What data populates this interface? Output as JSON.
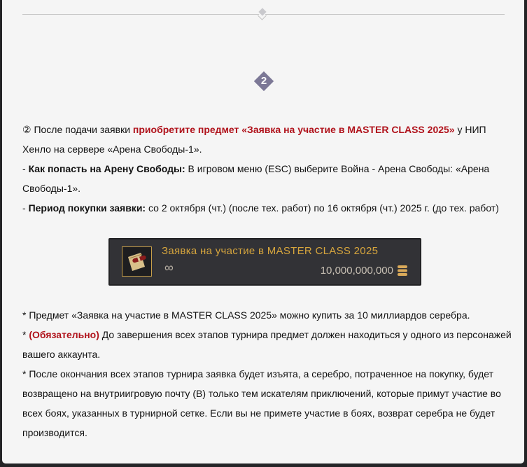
{
  "step_number": "2",
  "intro": {
    "marker": "②",
    "t1": " После подачи заявки ",
    "highlight": "приобретите предмет «Заявка на участие в MASTER CLASS 2025»",
    "t2": " у НИП Хенло на сервере «Арена Свободы-1»."
  },
  "how_to": {
    "prefix": "- ",
    "label": "Как попасть на Арену Свободы:",
    "text": " В игровом меню (ESC) выберите Война - Арена Свободы: «Арена Свободы-1»."
  },
  "period": {
    "prefix": "- ",
    "label": "Период покупки заявки:",
    "text": " со 2 октября (чт.) (после тех. работ) по 16 октября (чт.) 2025 г. (до тех. работ)"
  },
  "item_card": {
    "name": "Заявка на участие в MASTER CLASS 2025",
    "quantity": "∞",
    "price": "10,000,000,000",
    "icon": "scroll-icon",
    "currency_icon": "silver-coins-icon"
  },
  "notes": {
    "n1": " * Предмет «Заявка на участие в MASTER CLASS 2025» можно купить за 10 миллиардов серебра.",
    "n2_prefix": " * ",
    "n2_required": "(Обязательно)",
    "n2_text": " До завершения всех этапов турнира предмет должен находиться у одного из персонажей вашего аккаунта.",
    "n3": " * После окончания всех этапов турнира заявка будет изъята, а серебро, потраченное на покупку, будет возвращено на внутриигровую почту (B) только тем искателям приключений, которые примут участие во всех боях, указанных в турнирной сетке. Если вы не примете участие в боях, возврат серебра не будет производится."
  },
  "colors": {
    "accent_red": "#b0121b",
    "gold": "#d6a53d",
    "step_badge": "#7c7896"
  }
}
